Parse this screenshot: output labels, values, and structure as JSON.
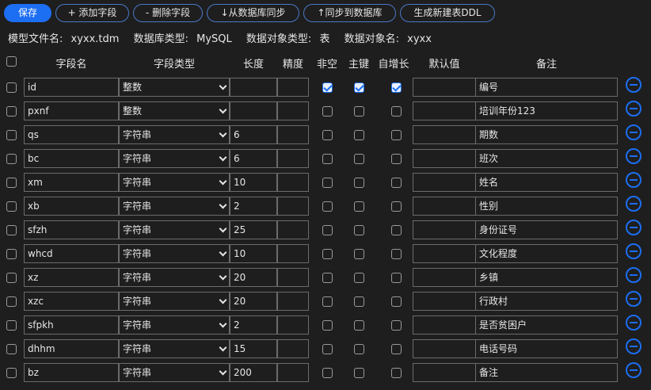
{
  "toolbar": {
    "save": "保存",
    "add_field": "+ 添加字段",
    "delete_field": "- 删除字段",
    "sync_from_db": "↓从数据库同步",
    "sync_to_db": "↑同步到数据库",
    "gen_ddl": "生成新建表DDL"
  },
  "info": {
    "model_file_label": "模型文件名:",
    "model_file_value": "xyxx.tdm",
    "db_type_label": "数据库类型:",
    "db_type_value": "MySQL",
    "obj_type_label": "数据对象类型:",
    "obj_type_value": "表",
    "obj_name_label": "数据对象名:",
    "obj_name_value": "xyxx"
  },
  "columns": {
    "name": "字段名",
    "type": "字段类型",
    "length": "长度",
    "precision": "精度",
    "not_null": "非空",
    "primary_key": "主键",
    "auto_inc": "自增长",
    "default": "默认值",
    "remark": "备注"
  },
  "fields": [
    {
      "name": "id",
      "type": "整数",
      "length": "",
      "precision": "",
      "not_null": true,
      "primary_key": true,
      "auto_inc": true,
      "default": "",
      "remark": "编号"
    },
    {
      "name": "pxnf",
      "type": "整数",
      "length": "",
      "precision": "",
      "not_null": false,
      "primary_key": false,
      "auto_inc": false,
      "default": "",
      "remark": "培训年份123"
    },
    {
      "name": "qs",
      "type": "字符串",
      "length": "6",
      "precision": "",
      "not_null": false,
      "primary_key": false,
      "auto_inc": false,
      "default": "",
      "remark": "期数"
    },
    {
      "name": "bc",
      "type": "字符串",
      "length": "6",
      "precision": "",
      "not_null": false,
      "primary_key": false,
      "auto_inc": false,
      "default": "",
      "remark": "班次"
    },
    {
      "name": "xm",
      "type": "字符串",
      "length": "10",
      "precision": "",
      "not_null": false,
      "primary_key": false,
      "auto_inc": false,
      "default": "",
      "remark": "姓名"
    },
    {
      "name": "xb",
      "type": "字符串",
      "length": "2",
      "precision": "",
      "not_null": false,
      "primary_key": false,
      "auto_inc": false,
      "default": "",
      "remark": "性别"
    },
    {
      "name": "sfzh",
      "type": "字符串",
      "length": "25",
      "precision": "",
      "not_null": false,
      "primary_key": false,
      "auto_inc": false,
      "default": "",
      "remark": "身份证号"
    },
    {
      "name": "whcd",
      "type": "字符串",
      "length": "10",
      "precision": "",
      "not_null": false,
      "primary_key": false,
      "auto_inc": false,
      "default": "",
      "remark": "文化程度"
    },
    {
      "name": "xz",
      "type": "字符串",
      "length": "20",
      "precision": "",
      "not_null": false,
      "primary_key": false,
      "auto_inc": false,
      "default": "",
      "remark": "乡镇"
    },
    {
      "name": "xzc",
      "type": "字符串",
      "length": "20",
      "precision": "",
      "not_null": false,
      "primary_key": false,
      "auto_inc": false,
      "default": "",
      "remark": "行政村"
    },
    {
      "name": "sfpkh",
      "type": "字符串",
      "length": "2",
      "precision": "",
      "not_null": false,
      "primary_key": false,
      "auto_inc": false,
      "default": "",
      "remark": "是否贫困户"
    },
    {
      "name": "dhhm",
      "type": "字符串",
      "length": "15",
      "precision": "",
      "not_null": false,
      "primary_key": false,
      "auto_inc": false,
      "default": "",
      "remark": "电话号码"
    },
    {
      "name": "bz",
      "type": "字符串",
      "length": "200",
      "precision": "",
      "not_null": false,
      "primary_key": false,
      "auto_inc": false,
      "default": "",
      "remark": "备注"
    }
  ],
  "colors": {
    "accent": "#1c6ef2",
    "background": "#1e1e1e",
    "border": "#6b6b6b"
  },
  "icons": {
    "delete_row": "minus-circle-icon",
    "dropdown": "chevron-down-icon",
    "checkbox": "checkbox-icon"
  }
}
